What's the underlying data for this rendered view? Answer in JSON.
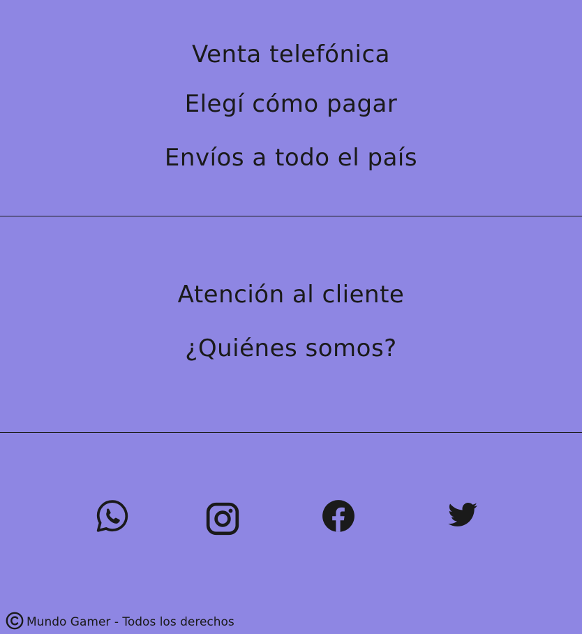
{
  "services": {
    "items": [
      {
        "label": "Venta telefónica"
      },
      {
        "label": "Elegí cómo pagar"
      },
      {
        "label": "Envíos a todo el país"
      }
    ]
  },
  "info": {
    "items": [
      {
        "label": "Atención al cliente"
      },
      {
        "label": "¿Quiénes somos?"
      }
    ]
  },
  "social": {
    "icons": [
      "whatsapp-icon",
      "instagram-icon",
      "facebook-icon",
      "twitter-icon"
    ]
  },
  "footer": {
    "copyright_text": "Mundo Gamer - Todos los derechos",
    "icon": "copyright-icon"
  },
  "colors": {
    "background": "#8e86e3",
    "text": "#1a1a1a"
  }
}
